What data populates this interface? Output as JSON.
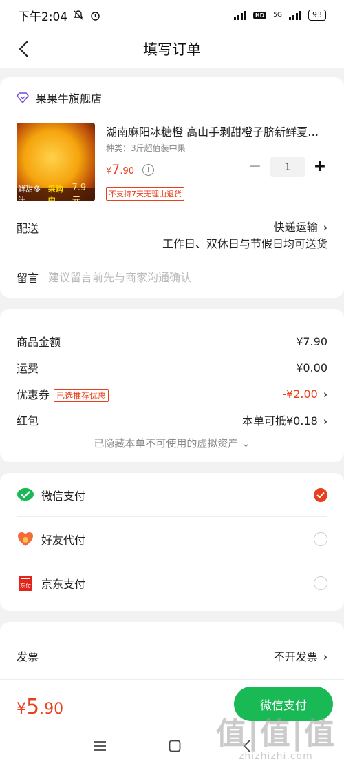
{
  "status_bar": {
    "time": "下午2:04",
    "network": "5G",
    "battery": "93"
  },
  "header": {
    "title": "填写订单"
  },
  "store": {
    "name": "果果牛旗舰店",
    "product": {
      "name": "湖南麻阳冰糖橙 高山手剥甜橙子脐新鲜夏…",
      "spec": "种类：3斤超值装中果",
      "price_symbol": "¥",
      "price_int": "7",
      "price_dec": ".90",
      "quantity": "1",
      "no_return": "不支持7天无理由退货",
      "image_tag_prefix": "鲜甜多汁",
      "image_tag_highlight": "采购中",
      "image_tag_price": "7.9元"
    },
    "delivery": {
      "label": "配送",
      "method": "快递运输",
      "detail": "工作日、双休日与节假日均可送货"
    },
    "memo": {
      "label": "留言",
      "placeholder": "建议留言前先与商家沟通确认"
    }
  },
  "summary": {
    "goods_label": "商品金额",
    "goods_value": "¥7.90",
    "shipping_label": "运费",
    "shipping_value": "¥0.00",
    "coupon_label": "优惠券",
    "coupon_tag": "已选推荐优惠",
    "coupon_value": "-¥2.00",
    "redpacket_label": "红包",
    "redpacket_value": "本单可抵¥0.18",
    "hidden_assets": "已隐藏本单不可使用的虚拟资产 ⌄"
  },
  "payment": {
    "options": [
      {
        "label": "微信支付",
        "icon": "wechat-pay-icon",
        "selected": true
      },
      {
        "label": "好友代付",
        "icon": "friend-pay-icon",
        "selected": false
      },
      {
        "label": "京东支付",
        "icon": "jd-pay-icon",
        "selected": false
      }
    ]
  },
  "invoice": {
    "label": "发票",
    "value": "不开发票"
  },
  "bottom": {
    "total_symbol": "¥",
    "total_int": "5",
    "total_dec": ".90",
    "pay_button": "微信支付"
  },
  "watermark": {
    "big": "值|值|值",
    "small": "zhizhizhi.com"
  },
  "colors": {
    "accent": "#e8401c",
    "wechat_green": "#19b955",
    "background": "#f2f2f2"
  }
}
